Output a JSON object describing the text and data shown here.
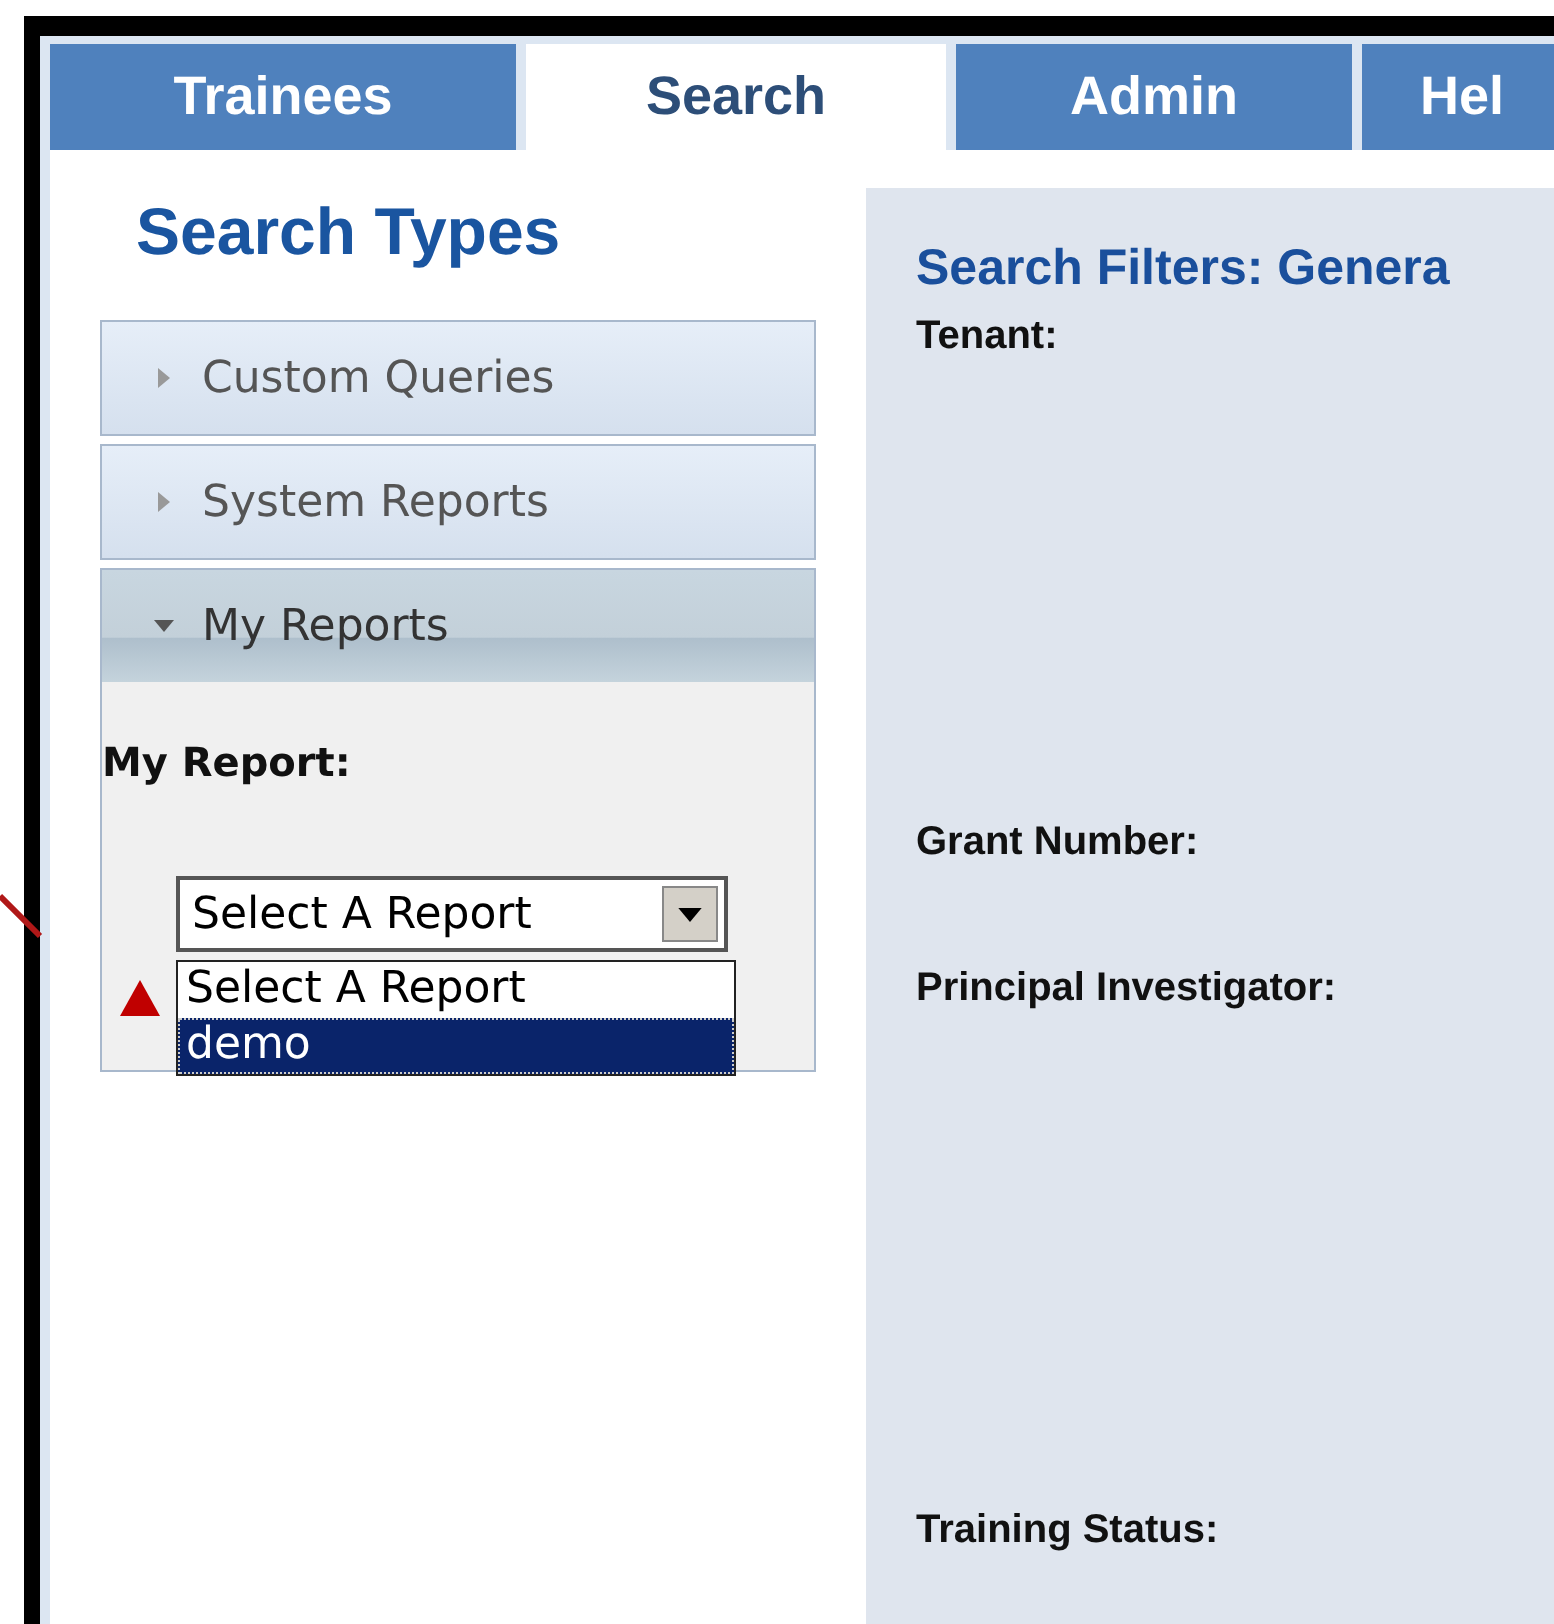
{
  "tabs": [
    {
      "label": "Trainees",
      "selected": false
    },
    {
      "label": "Search",
      "selected": true
    },
    {
      "label": "Admin",
      "selected": false
    },
    {
      "label": "Hel",
      "selected": false
    }
  ],
  "sidebar": {
    "title": "Search Types",
    "sections": [
      {
        "label": "Custom Queries",
        "expanded": false
      },
      {
        "label": "System Reports",
        "expanded": false
      },
      {
        "label": "My Reports",
        "expanded": true
      }
    ],
    "my_report": {
      "label": "My Report:",
      "select": {
        "value": "Select A Report",
        "options": [
          {
            "label": "Select A Report",
            "highlighted": false
          },
          {
            "label": "demo",
            "highlighted": true
          }
        ]
      }
    }
  },
  "filters": {
    "title": "Search Filters: Genera",
    "fields": [
      "Tenant:",
      "Grant Number:",
      "Principal Investigator:",
      "Training Status:"
    ]
  }
}
